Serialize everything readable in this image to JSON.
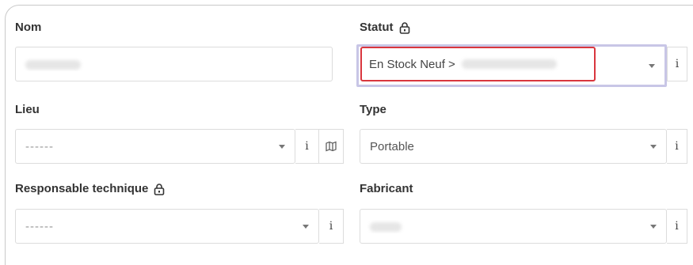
{
  "form": {
    "nom": {
      "label": "Nom",
      "value": ""
    },
    "statut": {
      "label": "Statut",
      "value": "En Stock Neuf >",
      "info": "i"
    },
    "lieu": {
      "label": "Lieu",
      "value": "------",
      "info": "i"
    },
    "type": {
      "label": "Type",
      "value": "Portable",
      "info": "i"
    },
    "responsable": {
      "label": "Responsable technique",
      "value": "------",
      "info": "i"
    },
    "fabricant": {
      "label": "Fabricant",
      "value": "",
      "info": "i"
    }
  },
  "icons": [
    "lock-icon",
    "map-icon",
    "chevron-down-icon"
  ],
  "colors": {
    "highlight": "#d9363e",
    "focus_ring": "#c8c6e6"
  }
}
